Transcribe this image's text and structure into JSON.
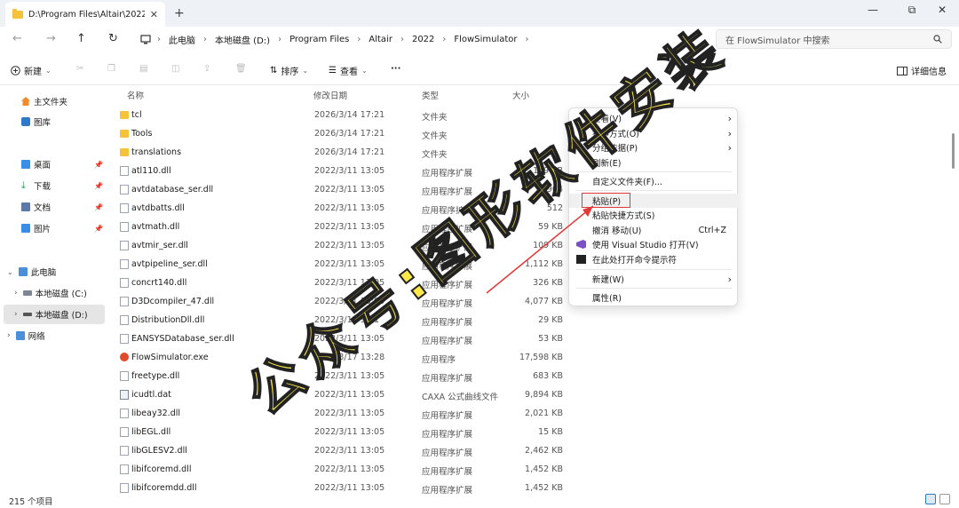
{
  "window": {
    "tab_title": "D:\\Program Files\\Altair\\2022\\",
    "tab_close": "✕",
    "new_tab": "+",
    "minimize": "—",
    "maximize": "⧉",
    "close": "✕"
  },
  "nav": {
    "back": "←",
    "forward": "→",
    "up": "↑",
    "refresh": "↻"
  },
  "breadcrumb": [
    "此电脑",
    "本地磁盘 (D:)",
    "Program Files",
    "Altair",
    "2022",
    "FlowSimulator"
  ],
  "breadcrumb_sep": "›",
  "search": {
    "placeholder": "在 FlowSimulator 中搜索"
  },
  "toolbar": {
    "new": "新建",
    "sort": "排序",
    "view": "查看",
    "more": "···",
    "details": "详细信息"
  },
  "sidebar": {
    "home": "主文件夹",
    "gallery": "图库",
    "desktop": "桌面",
    "downloads": "下载",
    "documents": "文档",
    "pictures": "图片",
    "this_pc": "此电脑",
    "drive_c": "本地磁盘 (C:)",
    "drive_d": "本地磁盘 (D:)",
    "network": "网络"
  },
  "columns": {
    "name": "名称",
    "date": "修改日期",
    "type": "类型",
    "size": "大小"
  },
  "files": [
    {
      "name": "tcl",
      "date": "2026/3/14 17:21",
      "type": "文件夹",
      "size": "",
      "kind": "folder"
    },
    {
      "name": "Tools",
      "date": "2026/3/14 17:21",
      "type": "文件夹",
      "size": "",
      "kind": "folder"
    },
    {
      "name": "translations",
      "date": "2026/3/14 17:21",
      "type": "文件夹",
      "size": "",
      "kind": "folder"
    },
    {
      "name": "atl110.dll",
      "date": "2022/3/11 13:05",
      "type": "应用程序扩展",
      "size": "189 KB",
      "kind": "file"
    },
    {
      "name": "avtdatabase_ser.dll",
      "date": "2022/3/11 13:05",
      "type": "应用程序扩展",
      "size": "904",
      "kind": "file"
    },
    {
      "name": "avtdbatts.dll",
      "date": "2022/3/11 13:05",
      "type": "应用程序扩展",
      "size": "512",
      "kind": "file"
    },
    {
      "name": "avtmath.dll",
      "date": "2022/3/11 13:05",
      "type": "应用程序扩展",
      "size": "59 KB",
      "kind": "file"
    },
    {
      "name": "avtmir_ser.dll",
      "date": "2022/3/11 13:05",
      "type": "应用程序扩展",
      "size": "109 KB",
      "kind": "file"
    },
    {
      "name": "avtpipeline_ser.dll",
      "date": "2022/3/11 13:05",
      "type": "应用程序扩展",
      "size": "1,112 KB",
      "kind": "file"
    },
    {
      "name": "concrt140.dll",
      "date": "2022/3/11 13:05",
      "type": "应用程序扩展",
      "size": "326 KB",
      "kind": "file"
    },
    {
      "name": "D3Dcompiler_47.dll",
      "date": "2022/3/11 13:05",
      "type": "应用程序扩展",
      "size": "4,077 KB",
      "kind": "file"
    },
    {
      "name": "DistributionDll.dll",
      "date": "2022/3/15 9:21",
      "type": "应用程序扩展",
      "size": "29 KB",
      "kind": "file"
    },
    {
      "name": "EANSYSDatabase_ser.dll",
      "date": "2022/3/11 13:05",
      "type": "应用程序扩展",
      "size": "53 KB",
      "kind": "file"
    },
    {
      "name": "FlowSimulator.exe",
      "date": "2022/3/17 13:28",
      "type": "应用程序",
      "size": "17,598 KB",
      "kind": "exe"
    },
    {
      "name": "freetype.dll",
      "date": "2022/3/11 13:05",
      "type": "应用程序扩展",
      "size": "683 KB",
      "kind": "file"
    },
    {
      "name": "icudtl.dat",
      "date": "2022/3/11 13:05",
      "type": "CAXA 公式曲线文件",
      "size": "9,894 KB",
      "kind": "dat"
    },
    {
      "name": "libeay32.dll",
      "date": "2022/3/11 13:05",
      "type": "应用程序扩展",
      "size": "2,021 KB",
      "kind": "file"
    },
    {
      "name": "libEGL.dll",
      "date": "2022/3/11 13:05",
      "type": "应用程序扩展",
      "size": "15 KB",
      "kind": "file"
    },
    {
      "name": "libGLESV2.dll",
      "date": "2022/3/11 13:05",
      "type": "应用程序扩展",
      "size": "2,462 KB",
      "kind": "file"
    },
    {
      "name": "libifcoremd.dll",
      "date": "2022/3/11 13:05",
      "type": "应用程序扩展",
      "size": "1,452 KB",
      "kind": "file"
    },
    {
      "name": "libifcoremdd.dll",
      "date": "2022/3/11 13:05",
      "type": "应用程序扩展",
      "size": "1,452 KB",
      "kind": "file"
    }
  ],
  "status": {
    "count": "215 个项目"
  },
  "context_menu": {
    "view": "查看(V)",
    "sort": "排序方式(O)",
    "group": "分组依据(P)",
    "refresh": "刷新(E)",
    "customize": "自定义文件夹(F)...",
    "paste": "粘贴(P)",
    "paste_shortcut": "粘贴快捷方式(S)",
    "undo": "撤消 移动(U)",
    "undo_shortcut": "Ctrl+Z",
    "open_vs": "使用 Visual Studio 打开(V)",
    "open_cmd": "在此处打开命令提示符",
    "new": "新建(W)",
    "properties": "属性(R)",
    "submenu_arrow": "›"
  },
  "watermark": {
    "text": "公众号:图形软件安装",
    "color": "#ffe94a"
  },
  "colors": {
    "highlight_box": "#e23a3a",
    "folder": "#f5c33b"
  }
}
